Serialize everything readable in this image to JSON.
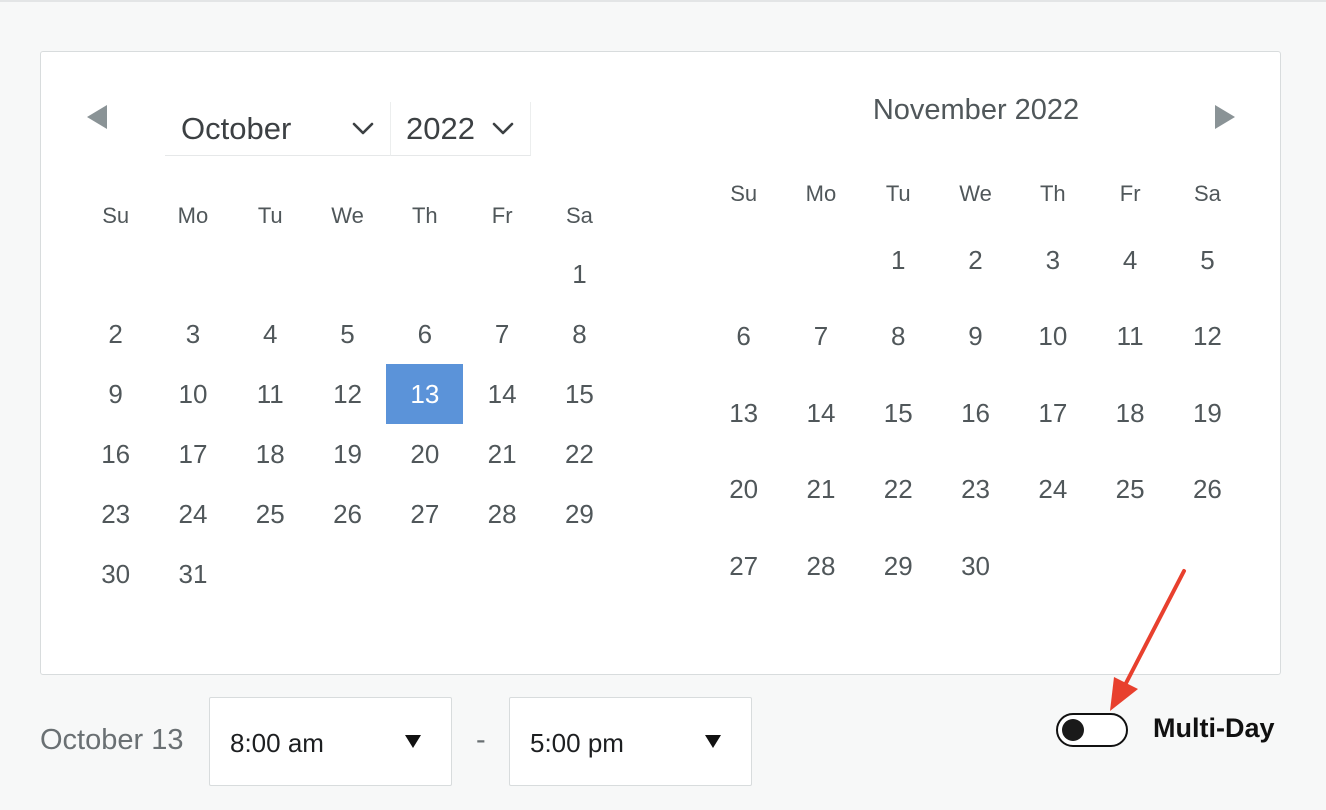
{
  "calendar": {
    "prev_icon": "triangle-left-icon",
    "next_icon": "triangle-right-icon",
    "month_select": {
      "value": "October",
      "icon": "chevron-down-icon"
    },
    "year_select": {
      "value": "2022",
      "icon": "chevron-down-icon"
    },
    "left_month": {
      "weekdays": [
        "Su",
        "Mo",
        "Tu",
        "We",
        "Th",
        "Fr",
        "Sa"
      ],
      "weeks": [
        [
          "",
          "",
          "",
          "",
          "",
          "",
          "1"
        ],
        [
          "2",
          "3",
          "4",
          "5",
          "6",
          "7",
          "8"
        ],
        [
          "9",
          "10",
          "11",
          "12",
          "13",
          "14",
          "15"
        ],
        [
          "16",
          "17",
          "18",
          "19",
          "20",
          "21",
          "22"
        ],
        [
          "23",
          "24",
          "25",
          "26",
          "27",
          "28",
          "29"
        ],
        [
          "30",
          "31",
          "",
          "",
          "",
          "",
          ""
        ]
      ],
      "selected_day": "13"
    },
    "right_month": {
      "title": "November 2022",
      "weekdays": [
        "Su",
        "Mo",
        "Tu",
        "We",
        "Th",
        "Fr",
        "Sa"
      ],
      "weeks": [
        [
          "",
          "",
          "1",
          "2",
          "3",
          "4",
          "5"
        ],
        [
          "6",
          "7",
          "8",
          "9",
          "10",
          "11",
          "12"
        ],
        [
          "13",
          "14",
          "15",
          "16",
          "17",
          "18",
          "19"
        ],
        [
          "20",
          "21",
          "22",
          "23",
          "24",
          "25",
          "26"
        ],
        [
          "27",
          "28",
          "29",
          "30",
          "",
          "",
          ""
        ]
      ]
    },
    "selected_color": "#5b93d9"
  },
  "footer": {
    "date_label": "October 13",
    "start_time": "8:00 am",
    "separator": "-",
    "end_time": "5:00 pm",
    "multi_day_label": "Multi-Day",
    "multi_day_on": false
  },
  "annotation": {
    "icon": "red-arrow-icon",
    "color": "#e8402e"
  }
}
